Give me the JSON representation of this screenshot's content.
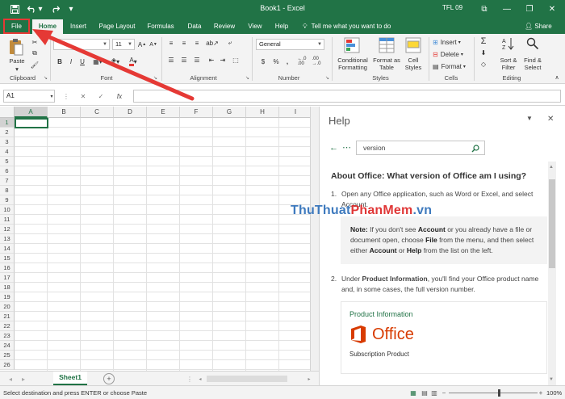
{
  "titlebar": {
    "title": "Book1  -  Excel",
    "user": "TFL 09",
    "restore_glyph": "⧉",
    "minimize_glyph": "—",
    "maximize_glyph": "❐",
    "close_glyph": "✕"
  },
  "tabs": [
    {
      "label": "File"
    },
    {
      "label": "Home"
    },
    {
      "label": "Insert"
    },
    {
      "label": "Page Layout"
    },
    {
      "label": "Formulas"
    },
    {
      "label": "Data"
    },
    {
      "label": "Review"
    },
    {
      "label": "View"
    },
    {
      "label": "Help"
    }
  ],
  "tellme": "Tell me what you want to do",
  "share": "Share",
  "ribbon": {
    "clipboard": {
      "paste": "Paste",
      "label": "Clipboard"
    },
    "font": {
      "name_value": "",
      "size_value": "11",
      "label": "Font",
      "bold": "B",
      "italic": "I",
      "underline": "U"
    },
    "alignment": {
      "label": "Alignment"
    },
    "number": {
      "format_value": "General",
      "label": "Number",
      "currency": "$",
      "percent": "%",
      "comma": ","
    },
    "styles": {
      "cond_format": "Conditional Formatting",
      "format_table": "Format as Table",
      "cell_styles": "Cell Styles",
      "label": "Styles"
    },
    "cells": {
      "insert": "Insert",
      "delete": "Delete",
      "format": "Format",
      "label": "Cells"
    },
    "editing": {
      "sort_filter": "Sort & Filter",
      "find_select": "Find & Select",
      "label": "Editing"
    }
  },
  "formula_bar": {
    "namebox": "A1",
    "fx": "fx",
    "cancel": "✕",
    "enter": "✓",
    "formula_value": ""
  },
  "grid": {
    "columns": [
      "A",
      "B",
      "C",
      "D",
      "E",
      "F",
      "G",
      "H",
      "I"
    ],
    "rows": [
      "1",
      "2",
      "3",
      "4",
      "5",
      "6",
      "7",
      "8",
      "9",
      "10",
      "11",
      "12",
      "13",
      "14",
      "15",
      "16",
      "17",
      "18",
      "19",
      "20",
      "21",
      "22",
      "23",
      "24",
      "25",
      "26"
    ]
  },
  "sheets": {
    "active": "Sheet1",
    "add": "+"
  },
  "help": {
    "title": "Help",
    "search_value": "version",
    "heading": "About Office: What version of Office am I using?",
    "step1_num": "1.",
    "step1_text": "Open any Office application, such as Word or Excel, and select Account.",
    "note_label": "Note:",
    "note_text_a": " If you don't see ",
    "note_account": "Account",
    "note_text_b": " or you already have a file or document open, choose ",
    "note_file": "File",
    "note_text_c": " from the menu, and then select either ",
    "note_account2": "Account",
    "note_text_d": " or ",
    "note_help": "Help",
    "note_text_e": " from the list on the left.",
    "step2_num": "2.",
    "step2_text_a": "Under ",
    "step2_bold": "Product Information",
    "step2_text_b": ", you'll find your Office product name and, in some cases, the full version number.",
    "product_info": "Product Information",
    "office_word": "Office",
    "subscription": "Subscription Product"
  },
  "watermark": {
    "part1": "ThuThuat",
    "part2": "PhanMem",
    "part3": ".vn"
  },
  "status": {
    "message": "Select destination and press ENTER or choose Paste",
    "zoom": "100%"
  },
  "colors": {
    "excel_green": "#217346",
    "highlight_red": "#e53935",
    "office_orange": "#d83b01"
  }
}
